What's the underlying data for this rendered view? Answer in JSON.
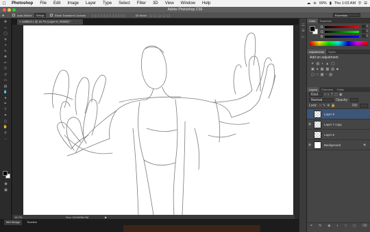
{
  "menubar": {
    "app": "Photoshop",
    "items": [
      "File",
      "Edit",
      "Image",
      "Layer",
      "Type",
      "Select",
      "Filter",
      "3D",
      "View",
      "Window",
      "Help"
    ],
    "battery": "99%",
    "clock": "Thu 1:03 AM"
  },
  "window": {
    "title": "Adobe Photoshop CS6"
  },
  "options": {
    "auto_select_label": "Auto-Select:",
    "auto_select_value": "Group",
    "transform_label": "Show Transform Controls",
    "mode_3d": "3D Mode:",
    "workspace": "Essentials"
  },
  "document": {
    "tab_label": "Untitled-1 @ 16.7% (Layer 5, RGB/8) *",
    "zoom": "16.7%",
    "doc_info": "Doc: 18.0M/96.0M"
  },
  "bottom_tabs": [
    "Mini Bridge",
    "Timeline"
  ],
  "color_panel": {
    "tabs": [
      "Color",
      "Swatches"
    ],
    "r": "0",
    "g": "0",
    "b": "0",
    "r_label": "R",
    "g_label": "G",
    "b_label": "B"
  },
  "adjustments_panel": {
    "tabs": [
      "Adjustments",
      "Styles"
    ],
    "heading": "Add an adjustment"
  },
  "layers_panel": {
    "tabs": [
      "Layers",
      "Channels",
      "Paths"
    ],
    "kind": "Kind",
    "blend_mode": "Normal",
    "opacity_label": "Opacity:",
    "lock_label": "Lock:",
    "fill_label": "Fill:",
    "layers": [
      {
        "name": "Layer 5",
        "selected": true,
        "visible": false
      },
      {
        "name": "Layer 7 copy",
        "selected": false,
        "visible": true
      },
      {
        "name": "Layer 6",
        "selected": false,
        "visible": false
      },
      {
        "name": "Background",
        "selected": false,
        "visible": true
      }
    ]
  },
  "colors": {
    "accent": "#3d5678",
    "canvas": "#ffffff",
    "panel": "#454545"
  }
}
